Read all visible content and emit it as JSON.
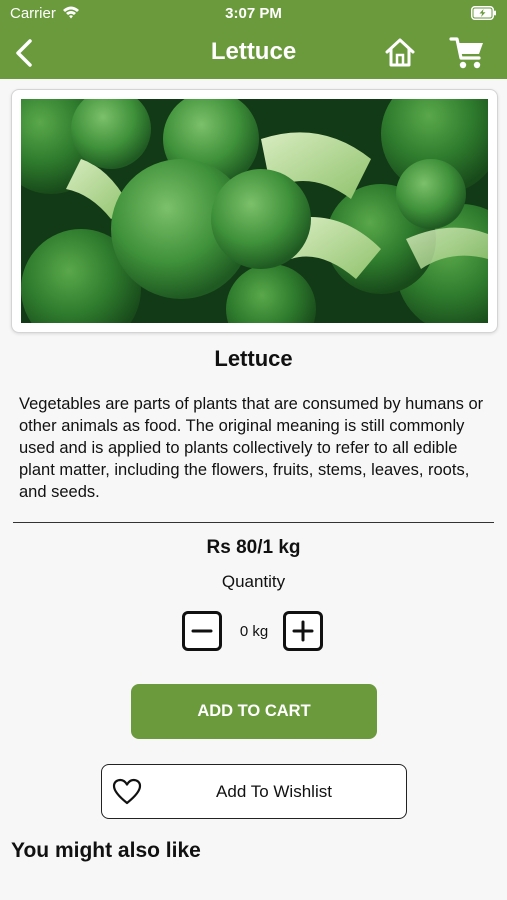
{
  "status_bar": {
    "carrier": "Carrier",
    "time": "3:07 PM",
    "wifi_icon": "wifi-icon",
    "battery_icon": "battery-charging-icon"
  },
  "nav": {
    "title": "Lettuce",
    "back_icon": "chevron-left-icon",
    "home_icon": "home-icon",
    "cart_icon": "shopping-cart-icon",
    "bar_color": "#6a9a3c"
  },
  "product": {
    "image": "broccoli-photo",
    "name": "Lettuce",
    "description": "Vegetables are parts of plants that are consumed by humans or other animals as food. The original meaning is still commonly used and is applied to plants collectively to refer to all edible plant matter, including the flowers, fruits, stems, leaves, roots, and seeds.",
    "price": "Rs 80/1 kg"
  },
  "quantity": {
    "label": "Quantity",
    "value": "0 kg",
    "minus_icon": "minus-icon",
    "plus_icon": "plus-icon"
  },
  "actions": {
    "add_to_cart": "ADD TO CART",
    "add_to_wishlist": "Add To Wishlist",
    "wishlist_icon": "heart-icon",
    "accent_color": "#6a9a3c"
  },
  "recommendations": {
    "title": "You might also like"
  }
}
